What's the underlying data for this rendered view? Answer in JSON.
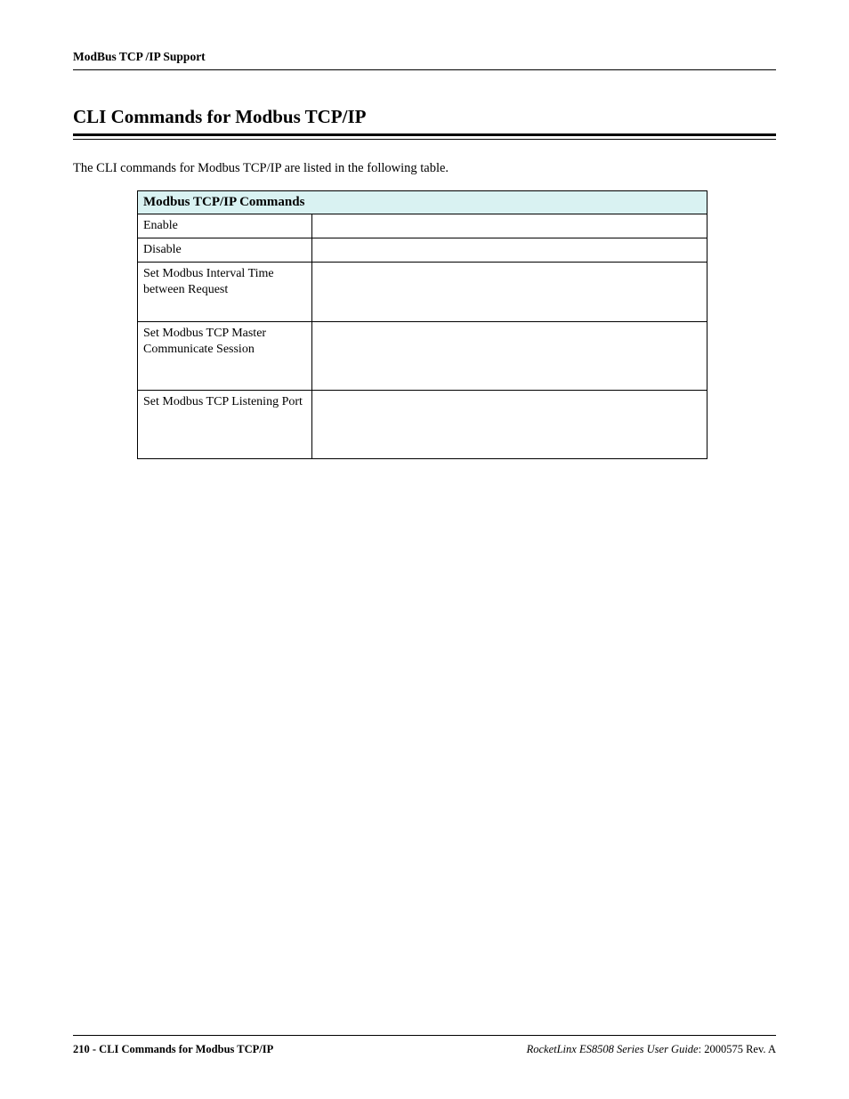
{
  "header": {
    "running": "ModBus TCP /IP Support"
  },
  "section": {
    "title": "CLI Commands for Modbus TCP/IP",
    "intro": "The CLI commands for Modbus TCP/IP are listed in the following table."
  },
  "table": {
    "caption": "Modbus TCP/IP Commands",
    "rows": [
      {
        "label": "Enable",
        "value": ""
      },
      {
        "label": "Disable",
        "value": ""
      },
      {
        "label": "Set Modbus Interval Time between Request",
        "value": ""
      },
      {
        "label": "Set Modbus TCP Master Communicate Session",
        "value": ""
      },
      {
        "label": "Set Modbus TCP Listening Port",
        "value": ""
      }
    ]
  },
  "footer": {
    "page_label": "210 - CLI Commands for Modbus TCP/IP",
    "doc_title": "RocketLinx ES8508 Series  User Guide",
    "doc_rev": ": 2000575 Rev. A"
  }
}
